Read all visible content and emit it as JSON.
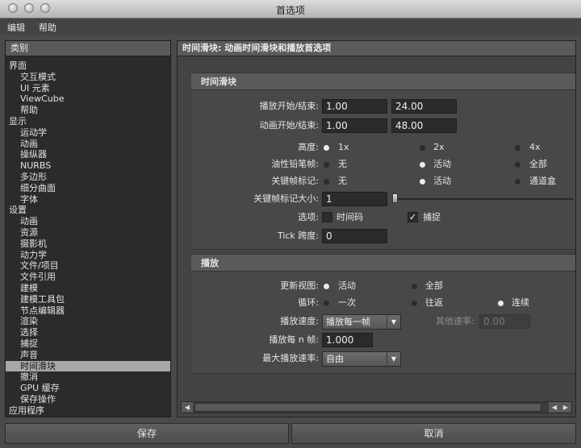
{
  "window": {
    "title": "首选项"
  },
  "menubar": {
    "items": [
      "编辑",
      "帮助"
    ]
  },
  "sidebar": {
    "header": "类别",
    "items": [
      {
        "label": "界面",
        "level": 0
      },
      {
        "label": "交互模式",
        "level": 1
      },
      {
        "label": "UI 元素",
        "level": 1
      },
      {
        "label": "ViewCube",
        "level": 1
      },
      {
        "label": "帮助",
        "level": 1
      },
      {
        "label": "显示",
        "level": 0
      },
      {
        "label": "运动学",
        "level": 1
      },
      {
        "label": "动画",
        "level": 1
      },
      {
        "label": "操纵器",
        "level": 1
      },
      {
        "label": "NURBS",
        "level": 1
      },
      {
        "label": "多边形",
        "level": 1
      },
      {
        "label": "细分曲面",
        "level": 1
      },
      {
        "label": "字体",
        "level": 1
      },
      {
        "label": "设置",
        "level": 0
      },
      {
        "label": "动画",
        "level": 1
      },
      {
        "label": "资源",
        "level": 1
      },
      {
        "label": "摄影机",
        "level": 1
      },
      {
        "label": "动力学",
        "level": 1
      },
      {
        "label": "文件/项目",
        "level": 1
      },
      {
        "label": "文件引用",
        "level": 1
      },
      {
        "label": "建模",
        "level": 1
      },
      {
        "label": "建模工具包",
        "level": 1
      },
      {
        "label": "节点编辑器",
        "level": 1
      },
      {
        "label": "渲染",
        "level": 1
      },
      {
        "label": "选择",
        "level": 1
      },
      {
        "label": "捕捉",
        "level": 1
      },
      {
        "label": "声音",
        "level": 1
      },
      {
        "label": "时间滑块",
        "level": 1,
        "selected": true
      },
      {
        "label": "撤消",
        "level": 1
      },
      {
        "label": "GPU 缓存",
        "level": 1
      },
      {
        "label": "保存操作",
        "level": 1
      },
      {
        "label": "应用程序",
        "level": 0
      }
    ]
  },
  "main": {
    "header": "时间滑块: 动画时间滑块和播放首选项",
    "time_slider": {
      "title": "时间滑块",
      "playback_range_label": "播放开始/结束:",
      "playback_start": "1.00",
      "playback_end": "24.00",
      "anim_range_label": "动画开始/结束:",
      "anim_start": "1.00",
      "anim_end": "48.00",
      "height_label": "高度:",
      "height_options": [
        "1x",
        "2x",
        "4x"
      ],
      "height_selected": "1x",
      "ghost_label": "油性铅笔帧:",
      "ghost_options": [
        "无",
        "活动",
        "全部"
      ],
      "ghost_selected": "活动",
      "keyticks_label": "关键帧标记:",
      "keyticks_options": [
        "无",
        "活动",
        "通道盒"
      ],
      "keyticks_selected": "活动",
      "keytick_size_label": "关键帧标记大小:",
      "keytick_size_value": "1",
      "options_label": "选项:",
      "timecode_label": "时间码",
      "timecode_checked": false,
      "snap_label": "捕捉",
      "snap_checked": true,
      "tick_span_label": "Tick 跨度:",
      "tick_span_value": "0"
    },
    "playback": {
      "title": "播放",
      "update_view_label": "更新视图:",
      "update_view_options": [
        "活动",
        "全部"
      ],
      "update_view_selected": "活动",
      "looping_label": "循环:",
      "looping_options": [
        "一次",
        "往返",
        "连续"
      ],
      "looping_selected": "连续",
      "speed_label": "播放速度:",
      "speed_value": "播放每一帧",
      "other_speed_label": "其他速率:",
      "other_speed_value": "0.00",
      "every_n_label": "播放每 n 帧:",
      "every_n_value": "1.000",
      "max_speed_label": "最大播放速率:",
      "max_speed_value": "自由"
    }
  },
  "footer": {
    "save_label": "保存",
    "cancel_label": "取消"
  }
}
